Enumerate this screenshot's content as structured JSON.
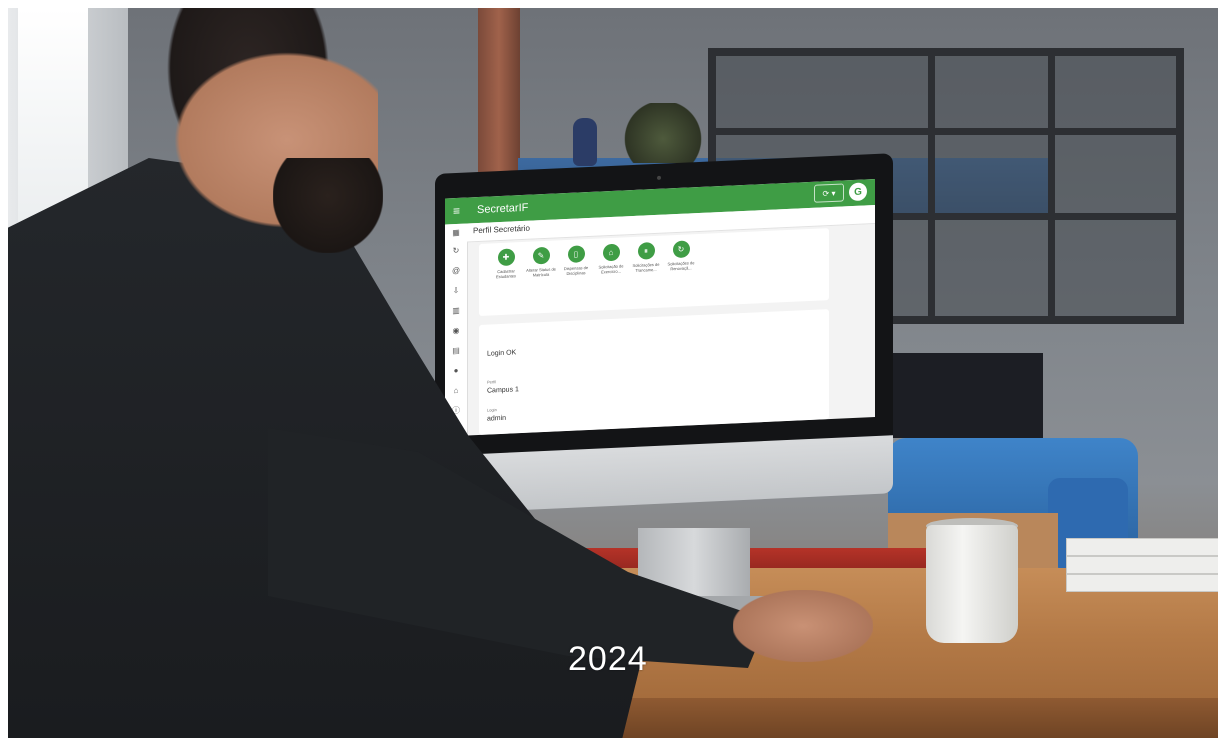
{
  "overlay": {
    "year": "2024"
  },
  "app": {
    "title": "SecretarIF",
    "avatar_letter": "G",
    "refresh_label": "⟳ ▾",
    "page_title": "Perfil Secretário",
    "accent_color": "#3f9d45",
    "actions": [
      {
        "label": "Cadastrar Estudantes",
        "icon": "add-user-icon"
      },
      {
        "label": "Alterar Status de Matrícula",
        "icon": "edit-user-icon"
      },
      {
        "label": "Dispensas de Disciplinas",
        "icon": "book-icon"
      },
      {
        "label": "Solicitação de Exercício...",
        "icon": "home-icon"
      },
      {
        "label": "Solicitações de Trancame...",
        "icon": "pause-icon"
      },
      {
        "label": "Solicitações de Renovaçã...",
        "icon": "refresh-icon"
      }
    ],
    "login": {
      "status": "Login OK",
      "perfil_label": "Perfil",
      "perfil_value": "Campus 1",
      "login_label": "Login",
      "login_value": "admin"
    },
    "rail_icons": [
      "grid-icon",
      "refresh-icon",
      "at-icon",
      "download-icon",
      "institution-icon",
      "location-icon",
      "document-icon",
      "github-icon",
      "lock-icon",
      "info-icon"
    ]
  }
}
